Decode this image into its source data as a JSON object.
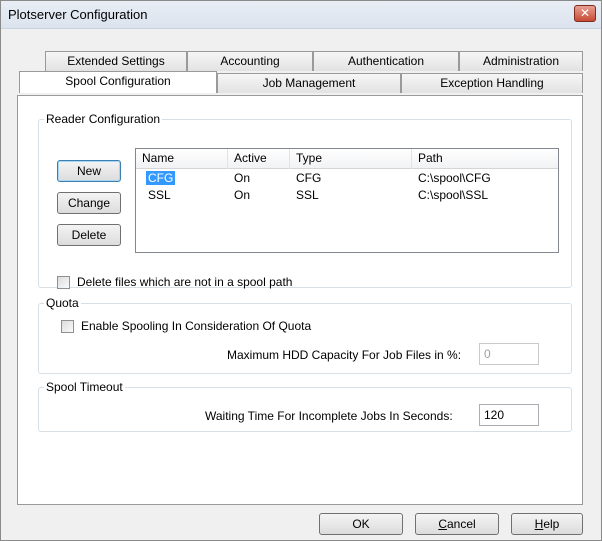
{
  "window": {
    "title": "Plotserver Configuration",
    "close_glyph": "✕"
  },
  "tabs": {
    "row1": [
      "Extended Settings",
      "Accounting",
      "Authentication",
      "Administration"
    ],
    "row2": [
      "Spool Configuration",
      "Job Management",
      "Exception Handling"
    ],
    "active": "Spool Configuration"
  },
  "reader": {
    "legend": "Reader Configuration",
    "buttons": {
      "new": "New",
      "change": "Change",
      "delete": "Delete"
    },
    "columns": [
      "Name",
      "Active",
      "Type",
      "Path"
    ],
    "rows": [
      {
        "name": "CFG",
        "active": "On",
        "type": "CFG",
        "path": "C:\\spool\\CFG",
        "selected": true
      },
      {
        "name": "SSL",
        "active": "On",
        "type": "SSL",
        "path": "C:\\spool\\SSL",
        "selected": false
      }
    ],
    "delete_files_label": "Delete files which are not in a spool path",
    "delete_files_checked": false
  },
  "quota": {
    "legend": "Quota",
    "enable_label": "Enable Spooling In Consideration Of Quota",
    "enable_checked": false,
    "max_capacity_label": "Maximum HDD Capacity For Job Files in %:",
    "max_capacity_value": "0"
  },
  "spool_timeout": {
    "legend": "Spool Timeout",
    "waiting_label": "Waiting Time For Incomplete Jobs In Seconds:",
    "waiting_value": "120"
  },
  "footer": {
    "ok": "OK",
    "cancel_mnemonic": "C",
    "cancel_rest": "ancel",
    "help_mnemonic": "H",
    "help_rest": "elp"
  },
  "colors": {
    "selection": "#3399ff",
    "close_button": "#c74a34"
  }
}
